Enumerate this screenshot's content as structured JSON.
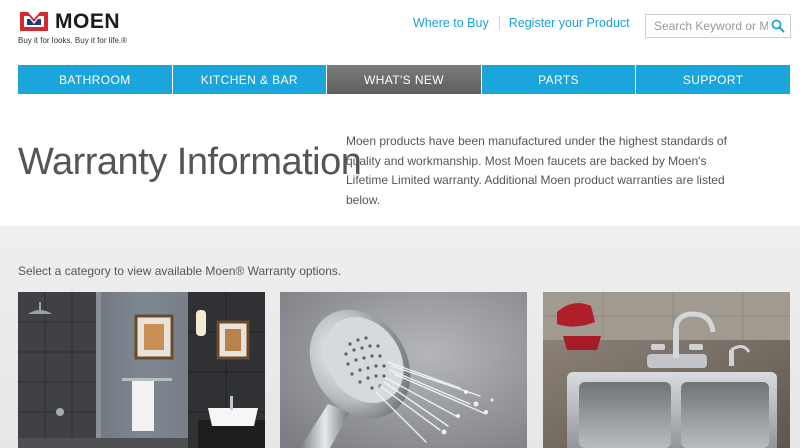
{
  "header": {
    "brand": "MOEN",
    "tagline": "Buy it for looks. Buy it for life.®",
    "links": {
      "where_to_buy": "Where to Buy",
      "register_product": "Register your Product"
    },
    "search": {
      "placeholder": "Search Keyword or Model #",
      "value": ""
    }
  },
  "nav": {
    "items": [
      {
        "label": "BATHROOM",
        "active": false
      },
      {
        "label": "KITCHEN & BAR",
        "active": false
      },
      {
        "label": "WHAT'S NEW",
        "active": true
      },
      {
        "label": "PARTS",
        "active": false
      },
      {
        "label": "SUPPORT",
        "active": false
      }
    ]
  },
  "intro": {
    "title": "Warranty Information",
    "description": "Moen products have been manufactured under the highest standards of quality and workmanship. Most Moen faucets are backed by Moen's Lifetime Limited warranty. Additional Moen product warranties are listed below."
  },
  "categories": {
    "prompt": "Select a category to view available Moen® Warranty options.",
    "cards": [
      {
        "image": "bathroom-photo"
      },
      {
        "image": "showerhead-photo"
      },
      {
        "image": "kitchen-sink-photo"
      }
    ]
  },
  "colors": {
    "accent_blue": "#1aa5dc",
    "nav_active_gray": "#6b6b6b",
    "logo_red": "#d7282f",
    "logo_navy": "#1f3b73"
  }
}
